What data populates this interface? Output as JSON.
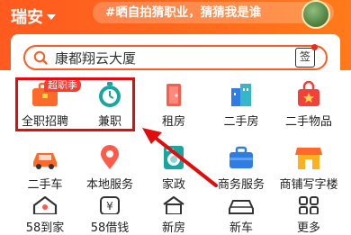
{
  "header": {
    "city": "瑞安",
    "topic": "#晒自拍猜职业，猜猜我是谁"
  },
  "search": {
    "text": "康都翔云大厦",
    "sign_label": "签"
  },
  "grid": [
    {
      "label": "全职招聘",
      "icon": "briefcase-icon",
      "badge": "超职季"
    },
    {
      "label": "兼职",
      "icon": "stopwatch-icon"
    },
    {
      "label": "租房",
      "icon": "door-icon"
    },
    {
      "label": "二手房",
      "icon": "buildings-icon"
    },
    {
      "label": "二手物品",
      "icon": "shopping-bag-icon"
    },
    {
      "label": "二手车",
      "icon": "car-icon"
    },
    {
      "label": "本地服务",
      "icon": "location-pin-icon"
    },
    {
      "label": "家政",
      "icon": "washing-machine-icon"
    },
    {
      "label": "商务服务",
      "icon": "briefcase-case-icon"
    },
    {
      "label": "商铺写字楼",
      "icon": "storefront-icon"
    },
    {
      "label": "58到家",
      "icon": "home-icon"
    },
    {
      "label": "58借钱",
      "icon": "yen-icon"
    },
    {
      "label": "新房",
      "icon": "house-icon"
    },
    {
      "label": "新车",
      "icon": "new-car-icon"
    },
    {
      "label": "更多",
      "icon": "more-icon"
    }
  ],
  "colors": {
    "brand": "#ff5a1f",
    "highlight": "#e10d0d"
  }
}
